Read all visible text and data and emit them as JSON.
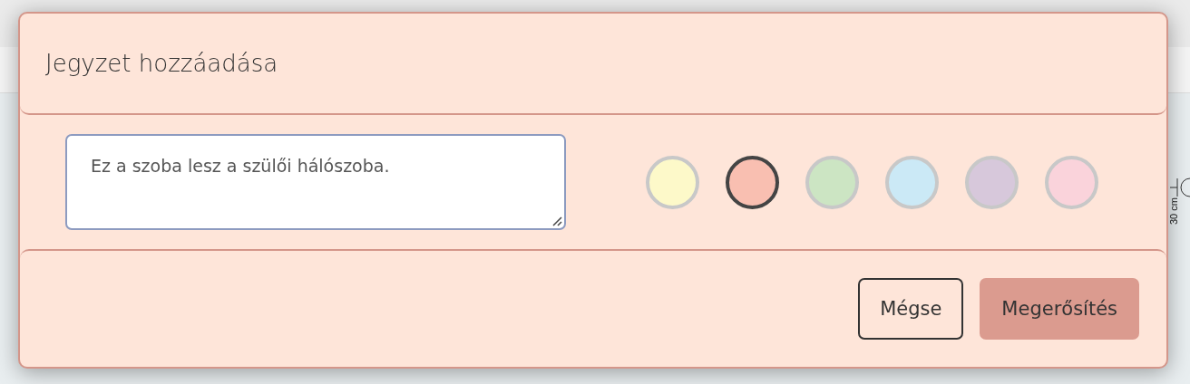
{
  "background": {
    "dimension_label": "30 cm"
  },
  "dialog": {
    "title": "Jegyzet hozzáadása",
    "note": {
      "value": "Ez a szoba lesz a szülői hálószoba."
    },
    "colors": [
      {
        "color": "#fdf9c9",
        "selected": false
      },
      {
        "color": "#f9bfb1",
        "selected": true
      },
      {
        "color": "#cce5c3",
        "selected": false
      },
      {
        "color": "#cbe9f6",
        "selected": false
      },
      {
        "color": "#d7c8db",
        "selected": false
      },
      {
        "color": "#fad3db",
        "selected": false
      }
    ],
    "buttons": [
      {
        "label": "Mégse",
        "kind": "secondary"
      },
      {
        "label": "Megerősítés",
        "kind": "primary"
      }
    ]
  }
}
